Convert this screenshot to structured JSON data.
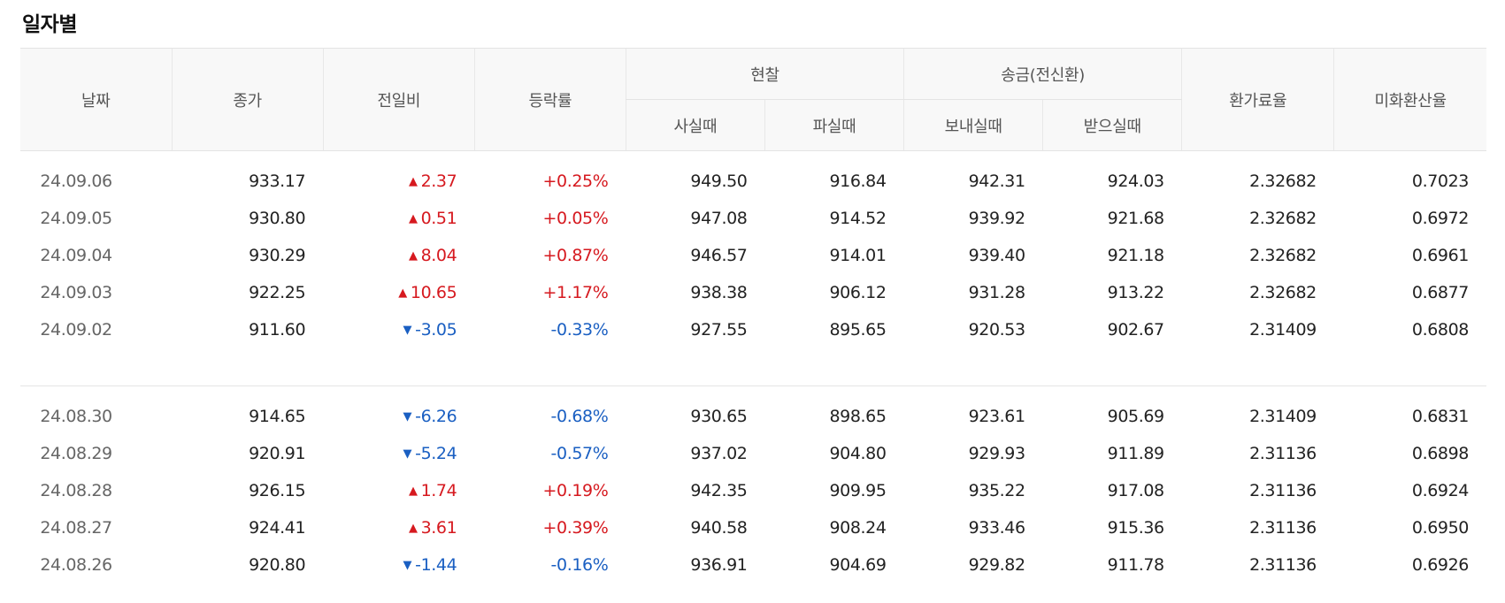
{
  "section_title": "일자별",
  "colors": {
    "up": "#d6191f",
    "down": "#1a5fc2"
  },
  "header": {
    "date": "날짜",
    "close": "종가",
    "change": "전일비",
    "pct": "등락률",
    "cash": "현찰",
    "cash_buy": "사실때",
    "cash_sell": "파실때",
    "wire": "송금(전신환)",
    "wire_send": "보내실때",
    "wire_recv": "받으실때",
    "fee_rate": "환가료율",
    "usd_rate": "미화환산율"
  },
  "groups": [
    {
      "rows": [
        {
          "date": "24.09.06",
          "close": "933.17",
          "dir": "up",
          "arrow": "▲",
          "change": "2.37",
          "pct": "+0.25%",
          "cash_buy": "949.50",
          "cash_sell": "916.84",
          "wire_send": "942.31",
          "wire_recv": "924.03",
          "fee": "2.32682",
          "usd": "0.7023"
        },
        {
          "date": "24.09.05",
          "close": "930.80",
          "dir": "up",
          "arrow": "▲",
          "change": "0.51",
          "pct": "+0.05%",
          "cash_buy": "947.08",
          "cash_sell": "914.52",
          "wire_send": "939.92",
          "wire_recv": "921.68",
          "fee": "2.32682",
          "usd": "0.6972"
        },
        {
          "date": "24.09.04",
          "close": "930.29",
          "dir": "up",
          "arrow": "▲",
          "change": "8.04",
          "pct": "+0.87%",
          "cash_buy": "946.57",
          "cash_sell": "914.01",
          "wire_send": "939.40",
          "wire_recv": "921.18",
          "fee": "2.32682",
          "usd": "0.6961"
        },
        {
          "date": "24.09.03",
          "close": "922.25",
          "dir": "up",
          "arrow": "▲",
          "change": "10.65",
          "pct": "+1.17%",
          "cash_buy": "938.38",
          "cash_sell": "906.12",
          "wire_send": "931.28",
          "wire_recv": "913.22",
          "fee": "2.32682",
          "usd": "0.6877"
        },
        {
          "date": "24.09.02",
          "close": "911.60",
          "dir": "down",
          "arrow": "▼",
          "change": "-3.05",
          "pct": "-0.33%",
          "cash_buy": "927.55",
          "cash_sell": "895.65",
          "wire_send": "920.53",
          "wire_recv": "902.67",
          "fee": "2.31409",
          "usd": "0.6808"
        }
      ]
    },
    {
      "rows": [
        {
          "date": "24.08.30",
          "close": "914.65",
          "dir": "down",
          "arrow": "▼",
          "change": "-6.26",
          "pct": "-0.68%",
          "cash_buy": "930.65",
          "cash_sell": "898.65",
          "wire_send": "923.61",
          "wire_recv": "905.69",
          "fee": "2.31409",
          "usd": "0.6831"
        },
        {
          "date": "24.08.29",
          "close": "920.91",
          "dir": "down",
          "arrow": "▼",
          "change": "-5.24",
          "pct": "-0.57%",
          "cash_buy": "937.02",
          "cash_sell": "904.80",
          "wire_send": "929.93",
          "wire_recv": "911.89",
          "fee": "2.31136",
          "usd": "0.6898"
        },
        {
          "date": "24.08.28",
          "close": "926.15",
          "dir": "up",
          "arrow": "▲",
          "change": "1.74",
          "pct": "+0.19%",
          "cash_buy": "942.35",
          "cash_sell": "909.95",
          "wire_send": "935.22",
          "wire_recv": "917.08",
          "fee": "2.31136",
          "usd": "0.6924"
        },
        {
          "date": "24.08.27",
          "close": "924.41",
          "dir": "up",
          "arrow": "▲",
          "change": "3.61",
          "pct": "+0.39%",
          "cash_buy": "940.58",
          "cash_sell": "908.24",
          "wire_send": "933.46",
          "wire_recv": "915.36",
          "fee": "2.31136",
          "usd": "0.6950"
        },
        {
          "date": "24.08.26",
          "close": "920.80",
          "dir": "down",
          "arrow": "▼",
          "change": "-1.44",
          "pct": "-0.16%",
          "cash_buy": "936.91",
          "cash_sell": "904.69",
          "wire_send": "929.82",
          "wire_recv": "911.78",
          "fee": "2.31136",
          "usd": "0.6926"
        }
      ]
    }
  ]
}
